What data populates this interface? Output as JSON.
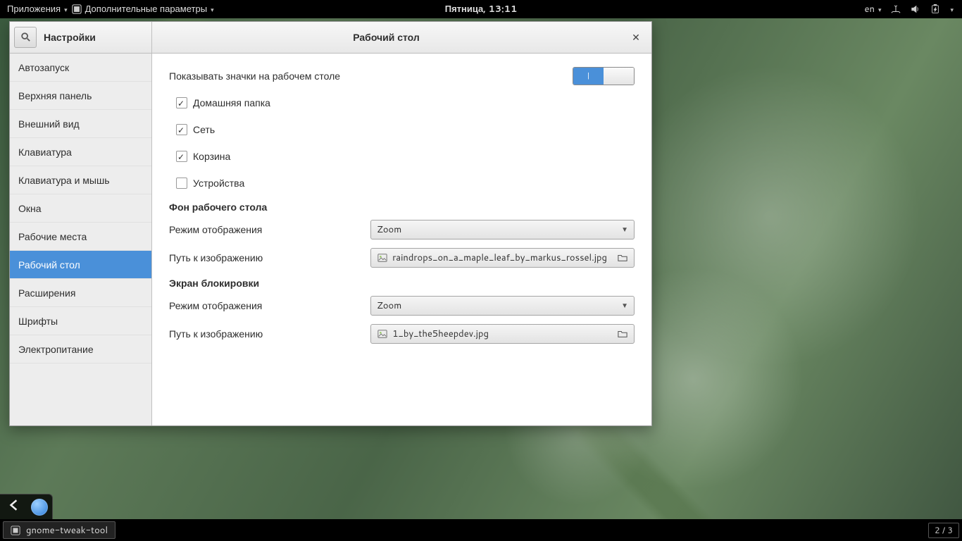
{
  "panel": {
    "applications_label": "Приложения",
    "app_menu_label": "Дополнительные параметры",
    "clock": "Пятница, 13:11",
    "lang": "en"
  },
  "window": {
    "app_title": "Настройки",
    "header_title": "Рабочий стол"
  },
  "sidebar": {
    "items": [
      {
        "label": "Автозапуск"
      },
      {
        "label": "Верхняя панель"
      },
      {
        "label": "Внешний вид"
      },
      {
        "label": "Клавиатура"
      },
      {
        "label": "Клавиатура и мышь"
      },
      {
        "label": "Окна"
      },
      {
        "label": "Рабочие места"
      },
      {
        "label": "Рабочий стол"
      },
      {
        "label": "Расширения"
      },
      {
        "label": "Шрифты"
      },
      {
        "label": "Электропитание"
      }
    ]
  },
  "content": {
    "show_icons_label": "Показывать значки на рабочем столе",
    "show_icons_on_mark": "|",
    "home_label": "Домашняя папка",
    "network_label": "Сеть",
    "trash_label": "Корзина",
    "devices_label": "Устройства",
    "bg_heading": "Фон рабочего стола",
    "bg_mode_label": "Режим отображения",
    "bg_mode_value": "Zoom",
    "bg_path_label": "Путь к изображению",
    "bg_path_value": "raindrops_on_a_maple_leaf_by_markus_rossel.jpg",
    "lock_heading": "Экран блокировки",
    "lock_mode_label": "Режим отображения",
    "lock_mode_value": "Zoom",
    "lock_path_label": "Путь к изображению",
    "lock_path_value": "1_by_the5heepdev.jpg"
  },
  "taskbar": {
    "item_label": "gnome-tweak-tool",
    "workspace": "2 / 3"
  }
}
